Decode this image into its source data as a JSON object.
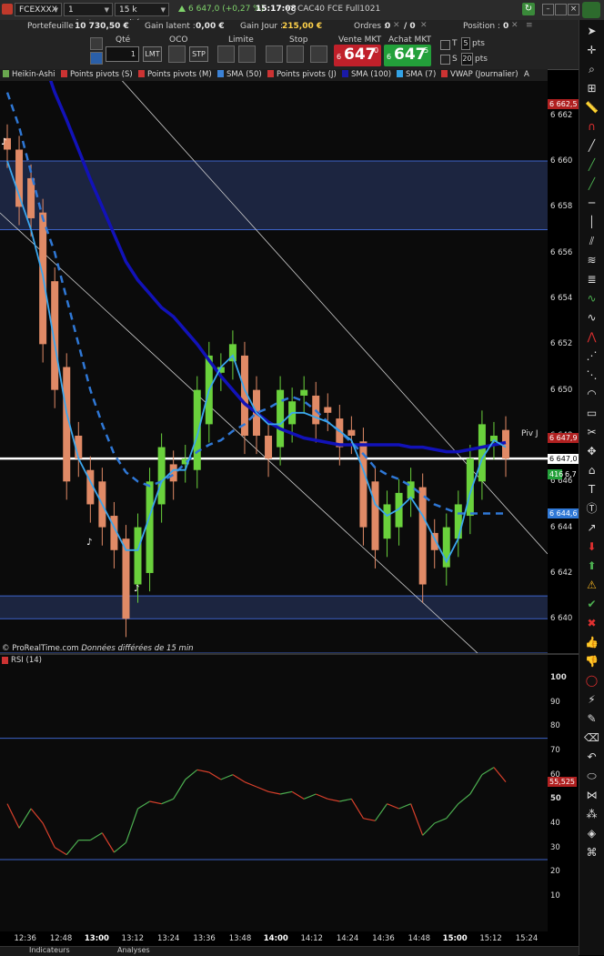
{
  "toolbar": {
    "instrument": "FCEXXXX",
    "interval": "1 minute",
    "units": "15 k unités",
    "price_change": "6 647,0 (+0,27 %)",
    "time": "15:17:08",
    "contract": "CAC40 FCE Full1021"
  },
  "account": {
    "portefeuille_label": "Portefeuille :",
    "portefeuille_value": "10 730,50 €",
    "gain_latent_label": "Gain latent :",
    "gain_latent_value": "0,00 €",
    "gain_jour_label": "Gain Jour :",
    "gain_jour_value": "215,00 €",
    "ordres_label": "Ordres :",
    "ordres_value": "0",
    "ordres_count": "/ 0",
    "position_label": "Position :",
    "position_value": "0"
  },
  "order_panel": {
    "qte_label": "Qté",
    "qte_value": "1",
    "lmt": "LMT",
    "oco_label": "OCO",
    "stp": "STP",
    "limite_label": "Limite",
    "stop_label": "Stop",
    "vente_label": "Vente MKT",
    "vente_big": "647",
    "vente_prefix": "6",
    "vente_sup": "0",
    "achat_label": "Achat MKT",
    "achat_big": "647",
    "achat_prefix": "6",
    "achat_sup": "5",
    "t_label": "T",
    "t_value": "5",
    "pts1": "pts",
    "s_label": "S",
    "s_value": "20",
    "pts2": "pts"
  },
  "indicators": [
    {
      "label": "Heikin-Ashi",
      "color": "#6aa84f"
    },
    {
      "label": "Points pivots (S)",
      "color": "#cc3333"
    },
    {
      "label": "Points pivots (M)",
      "color": "#cc3333"
    },
    {
      "label": "SMA (50)",
      "color": "#3b82d6"
    },
    {
      "label": "Points pivots (J)",
      "color": "#cc3333"
    },
    {
      "label": "SMA (100)",
      "color": "#1a1aa8"
    },
    {
      "label": "SMA (7)",
      "color": "#33a3e6"
    },
    {
      "label": "VWAP (Journalier)",
      "color": "#cc3333"
    },
    {
      "label": "A",
      "color": ""
    }
  ],
  "price_axis": {
    "ticks": [
      "6 662",
      "6 660",
      "6 658",
      "6 656",
      "6 654",
      "6 652",
      "6 650",
      "6 648",
      "6 646",
      "6 644",
      "6 642",
      "6 640"
    ],
    "tag_top": "6 662,5",
    "tag_current": "6 647,9",
    "tag_mid": "6 647,0",
    "tag_small": "416",
    "tag_small2": "6,7",
    "tag_blue": "6 644,6",
    "piv_label": "Piv J"
  },
  "watermark": "© ProRealTime.com",
  "watermark_note": "Données différées de 15 min",
  "rsi": {
    "label": "RSI (14)",
    "ticks": [
      "100",
      "90",
      "80",
      "70",
      "60",
      "50",
      "40",
      "30",
      "20",
      "10"
    ],
    "current_tag": "55,525"
  },
  "time_axis": [
    "12:36",
    "12:48",
    "13:00",
    "13:12",
    "13:24",
    "13:36",
    "13:48",
    "14:00",
    "14:12",
    "14:24",
    "14:36",
    "14:48",
    "15:00",
    "15:12",
    "15:24"
  ],
  "bottom": {
    "tab1": "Indicateurs",
    "tab2": "Analyses"
  },
  "chart_data": {
    "type": "candlestick",
    "x_time": [
      "12:30",
      "12:34",
      "12:38",
      "12:42",
      "12:46",
      "12:50",
      "12:54",
      "12:58",
      "13:02",
      "13:06",
      "13:10",
      "13:14",
      "13:18",
      "13:22",
      "13:26",
      "13:30",
      "13:34",
      "13:38",
      "13:42",
      "13:46",
      "13:50",
      "13:54",
      "13:58",
      "14:02",
      "14:06",
      "14:10",
      "14:14",
      "14:18",
      "14:22",
      "14:26",
      "14:30",
      "14:34",
      "14:38",
      "14:42",
      "14:46",
      "14:50",
      "14:54",
      "14:58",
      "15:02",
      "15:06",
      "15:10",
      "15:14",
      "15:17"
    ],
    "close": [
      6660.5,
      6658,
      6657.5,
      6652,
      6650,
      6646,
      6647,
      6645,
      6644,
      6643,
      6640,
      6644,
      6646,
      6647.5,
      6646,
      6647,
      6650,
      6651.5,
      6651,
      6652,
      6648,
      6648,
      6647,
      6650,
      6649.5,
      6650,
      6648.5,
      6649,
      6647.5,
      6648,
      6644,
      6643,
      6645,
      6645.5,
      6646,
      6641.5,
      6643,
      6644,
      6645,
      6647,
      6648.5,
      6648,
      6647
    ],
    "sma7": [
      6660,
      6658.5,
      6657,
      6655,
      6652,
      6649,
      6647,
      6646,
      6645,
      6644,
      6643,
      6643,
      6644.5,
      6646,
      6646.5,
      6646.5,
      6648,
      6650,
      6651,
      6651.5,
      6650,
      6649,
      6648.5,
      6648.5,
      6649,
      6649,
      6648.8,
      6648.6,
      6648.2,
      6647.8,
      6646.5,
      6645,
      6644.5,
      6644.8,
      6645.3,
      6644.5,
      6643.5,
      6642.5,
      6643.5,
      6645.5,
      6647,
      6647.8,
      6647.5
    ],
    "sma50": [
      6663,
      6661.5,
      6659.5,
      6657.5,
      6656,
      6654,
      6652,
      6650,
      6648.5,
      6647.2,
      6646.4,
      6646,
      6645.8,
      6646,
      6646.3,
      6646.8,
      6647.3,
      6647.6,
      6647.8,
      6648.2,
      6648.5,
      6649,
      6649.2,
      6649.5,
      6649.7,
      6649.5,
      6649.1,
      6648.6,
      6648.2,
      6647.7,
      6647.2,
      6646.6,
      6646.3,
      6646.1,
      6645.8,
      6645.4,
      6645,
      6644.8,
      6644.6,
      6644.6,
      6644.6,
      6644.6,
      6644.6
    ],
    "sma100": [
      6668,
      6667,
      6666,
      6664.5,
      6663,
      6661.8,
      6660.5,
      6659.2,
      6658,
      6656.8,
      6655.6,
      6654.8,
      6654.2,
      6653.6,
      6653.2,
      6652.6,
      6652,
      6651.3,
      6650.6,
      6650,
      6649.4,
      6649,
      6648.6,
      6648.3,
      6648.1,
      6647.9,
      6647.8,
      6647.7,
      6647.6,
      6647.6,
      6647.6,
      6647.6,
      6647.6,
      6647.6,
      6647.5,
      6647.5,
      6647.4,
      6647.3,
      6647.3,
      6647.4,
      6647.5,
      6647.6,
      6647.7
    ],
    "rsi14": [
      48,
      38,
      46,
      40,
      30,
      27,
      33,
      33,
      36,
      28,
      32,
      46,
      49,
      48,
      50,
      58,
      62,
      61,
      58,
      60,
      57,
      55,
      53,
      52,
      53,
      50,
      52,
      50,
      49,
      50,
      42,
      41,
      48,
      46,
      48,
      35,
      40,
      42,
      48,
      52,
      60,
      63,
      57
    ],
    "ylim_price": [
      6638.5,
      6663.5
    ],
    "ylim_rsi": [
      0,
      100
    ],
    "rsi_levels": [
      75,
      25
    ]
  }
}
